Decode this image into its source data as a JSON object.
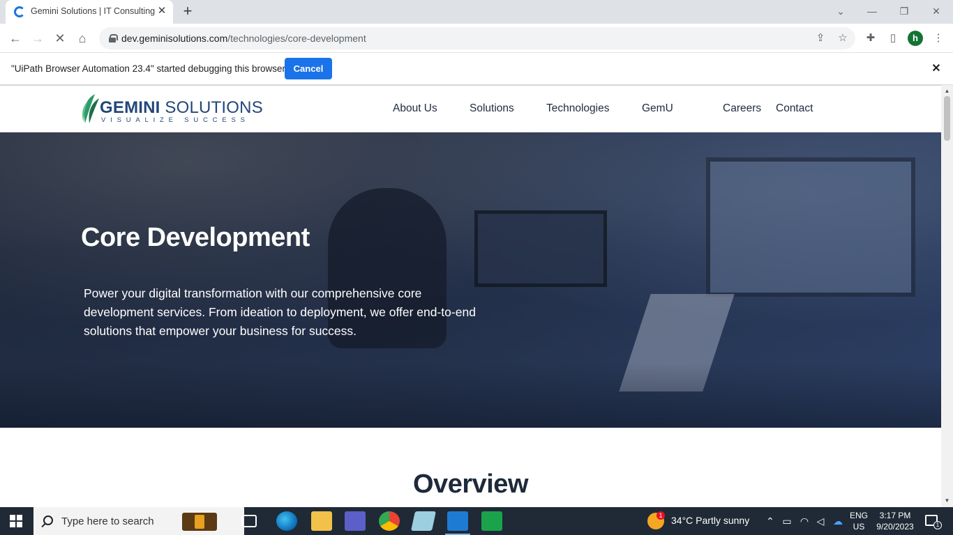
{
  "browser": {
    "tab_title": "Gemini Solutions | IT Consulting",
    "url_host": "dev.geminisolutions.com",
    "url_path": "/technologies/core-development",
    "profile_initial": "h",
    "infobar_text": "\"UiPath Browser Automation 23.4\" started debugging this browser",
    "infobar_cancel": "Cancel"
  },
  "site": {
    "logo_name_bold": "GEMINI",
    "logo_name_rest": " SOLUTIONS",
    "logo_tagline": "VISUALIZE SUCCESS",
    "nav": [
      "About Us",
      "Solutions",
      "Technologies",
      "GemU",
      "Careers",
      "Contact"
    ],
    "hero_title": "Core Development",
    "hero_body": "Power your digital transformation with our comprehensive core development services. From ideation to deployment, we offer end-to-end solutions that empower your business for success.",
    "section_title": "Overview"
  },
  "taskbar": {
    "search_placeholder": "Type here to search",
    "weather": "34°C  Partly sunny",
    "weather_badge": "1",
    "lang_top": "ENG",
    "lang_bottom": "US",
    "time": "3:17 PM",
    "date": "9/20/2023",
    "notification_count": "1"
  },
  "colors": {
    "brand_navy": "#24477a",
    "brand_green": "#2e9b6a",
    "chrome_blue": "#1a73e8"
  }
}
